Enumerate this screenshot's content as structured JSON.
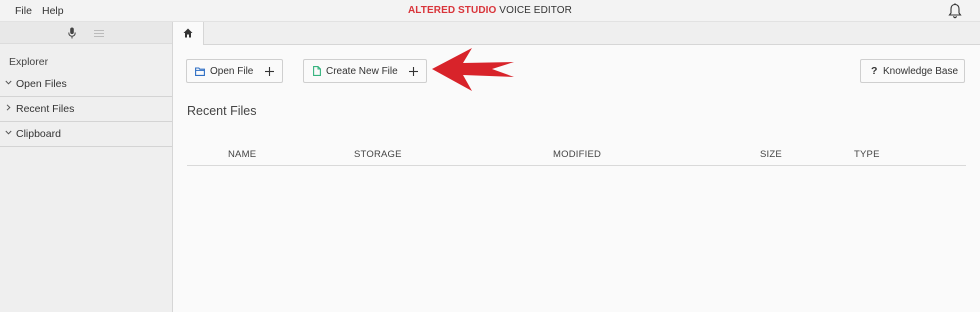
{
  "menu": {
    "file": "File",
    "help": "Help"
  },
  "app_title": {
    "brand": "ALTERED STUDIO",
    "rest": " VOICE EDITOR"
  },
  "sidebar": {
    "explorer_label": "Explorer",
    "items": [
      {
        "label": "Open Files",
        "expanded": true
      },
      {
        "label": "Recent Files",
        "expanded": false
      },
      {
        "label": "Clipboard",
        "expanded": true
      }
    ]
  },
  "toolbar": {
    "open_file": "Open File",
    "create_new_file": "Create New File",
    "knowledge_base": "Knowledge Base",
    "knowledge_base_icon": "?"
  },
  "recent_files": {
    "title": "Recent Files",
    "columns": [
      "NAME",
      "STORAGE",
      "MODIFIED",
      "SIZE",
      "TYPE"
    ],
    "rows": []
  },
  "icons": [
    "bell-icon",
    "mic-icon",
    "menu-icon",
    "home-icon",
    "folder-icon",
    "new-file-icon",
    "plus-icon",
    "chevron-down-icon",
    "chevron-right-icon",
    "help-icon",
    "arrow-annotation"
  ],
  "colors": {
    "brand": "#d9343a",
    "folder_icon": "#2f6fc4",
    "new_file_icon": "#35b37e",
    "annotation_arrow": "#d8232a"
  }
}
